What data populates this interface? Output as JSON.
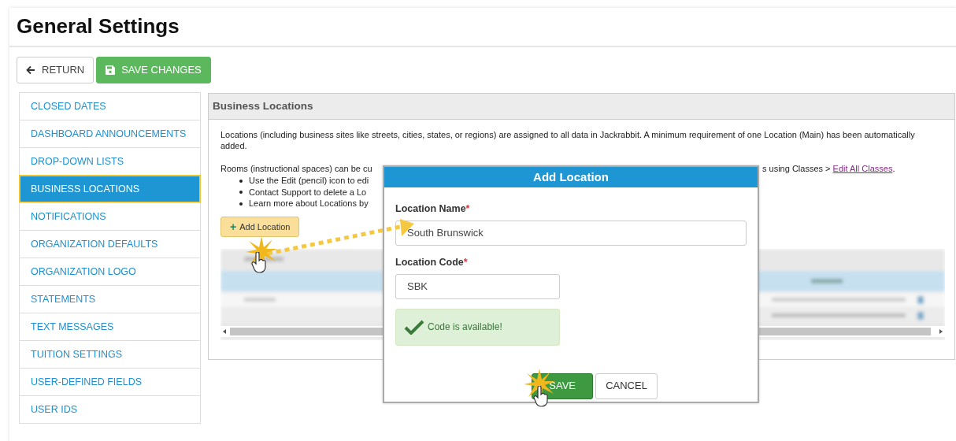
{
  "page": {
    "title": "General Settings"
  },
  "toolbar": {
    "buttons": [
      {
        "label": "RETURN",
        "kind": "return"
      },
      {
        "label": "SAVE CHANGES",
        "kind": "save"
      }
    ]
  },
  "sidebar": {
    "items": [
      {
        "label": "CLOSED DATES",
        "selected": false
      },
      {
        "label": "DASHBOARD ANNOUNCEMENTS",
        "selected": false
      },
      {
        "label": "DROP-DOWN LISTS",
        "selected": false
      },
      {
        "label": "BUSINESS LOCATIONS",
        "selected": true
      },
      {
        "label": "NOTIFICATIONS",
        "selected": false
      },
      {
        "label": "ORGANIZATION DEFAULTS",
        "selected": false
      },
      {
        "label": "ORGANIZATION LOGO",
        "selected": false
      },
      {
        "label": "STATEMENTS",
        "selected": false
      },
      {
        "label": "TEXT MESSAGES",
        "selected": false
      },
      {
        "label": "TUITION SETTINGS",
        "selected": false
      },
      {
        "label": "USER-DEFINED FIELDS",
        "selected": false
      },
      {
        "label": "USER IDS",
        "selected": false
      }
    ]
  },
  "panel": {
    "title": "Business Locations",
    "intro": "Locations (including business sites like streets, cities, states, or regions) are assigned to all data in Jackrabbit. A minimum requirement of one Location (Main) has been automatically added.",
    "rooms_start": "Rooms (instructional spaces) can be cu",
    "rooms_end": "s using Classes > ",
    "rooms_link": "Edit All Classes",
    "rooms_tail": ".",
    "bullets": [
      "Use the Edit (pencil) icon to edi",
      "Contact Support to delete a Lo",
      "Learn more about Locations by"
    ],
    "add_button": {
      "icon": "+",
      "label": "Add Location"
    }
  },
  "dialog": {
    "title": "Add Location",
    "fields": [
      {
        "label": "Location Name",
        "required_mark": "*",
        "value": "South Brunswick"
      },
      {
        "label": "Location Code",
        "required_mark": "*",
        "value": "SBK"
      }
    ],
    "status": "Code is available!",
    "buttons": [
      {
        "label": "SAVE",
        "kind": "primary"
      },
      {
        "label": "CANCEL",
        "kind": "secondary"
      }
    ]
  }
}
